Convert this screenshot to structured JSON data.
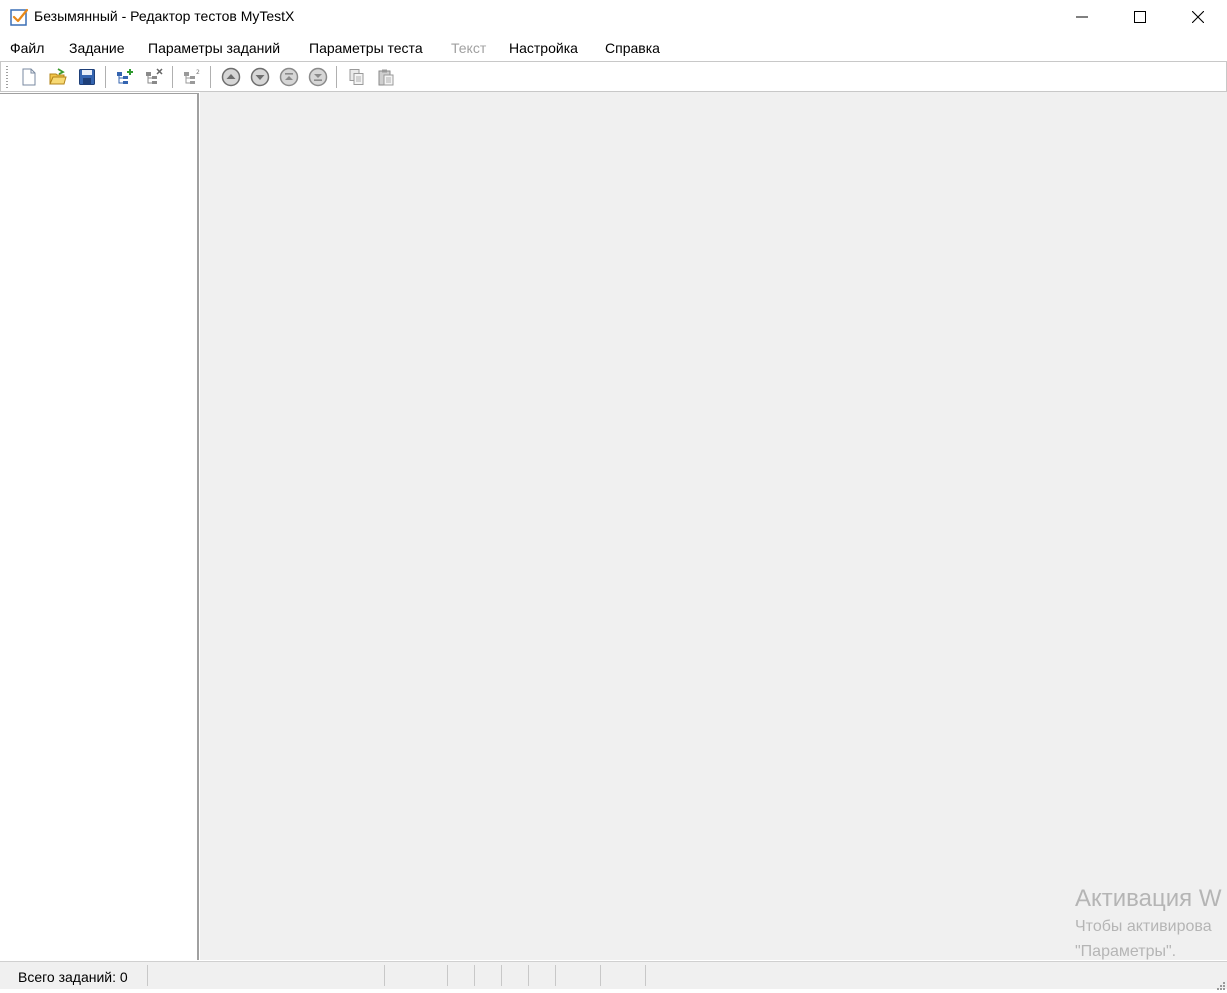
{
  "window": {
    "title": "Безымянный - Редактор тестов MyTestX",
    "controls": [
      "minimize",
      "maximize",
      "close"
    ]
  },
  "menu": [
    {
      "label": "Файл",
      "enabled": true
    },
    {
      "label": "Задание",
      "enabled": true
    },
    {
      "label": "Параметры заданий",
      "enabled": true
    },
    {
      "label": "Параметры теста",
      "enabled": true
    },
    {
      "label": "Текст",
      "enabled": false
    },
    {
      "label": "Настройка",
      "enabled": true
    },
    {
      "label": "Справка",
      "enabled": true
    }
  ],
  "toolbar": {
    "buttons": [
      "new-document-icon",
      "open-folder-icon",
      "save-disk-icon",
      "add-task-icon",
      "delete-task-icon",
      "renumber-tasks-icon",
      "move-up-icon",
      "move-down-icon",
      "move-top-icon",
      "move-bottom-icon",
      "copy-icon",
      "paste-icon"
    ]
  },
  "watermark": {
    "title": "Активация W",
    "line1": "Чтобы активирова",
    "line2": "\"Параметры\"."
  },
  "statusbar": {
    "task_count": "Всего заданий: 0"
  },
  "colors": {
    "main_bg": "#f0f0f0",
    "panel_bg": "#ffffff",
    "disabled_text": "#a0a0a0",
    "watermark_text": "#b5b5b5"
  }
}
